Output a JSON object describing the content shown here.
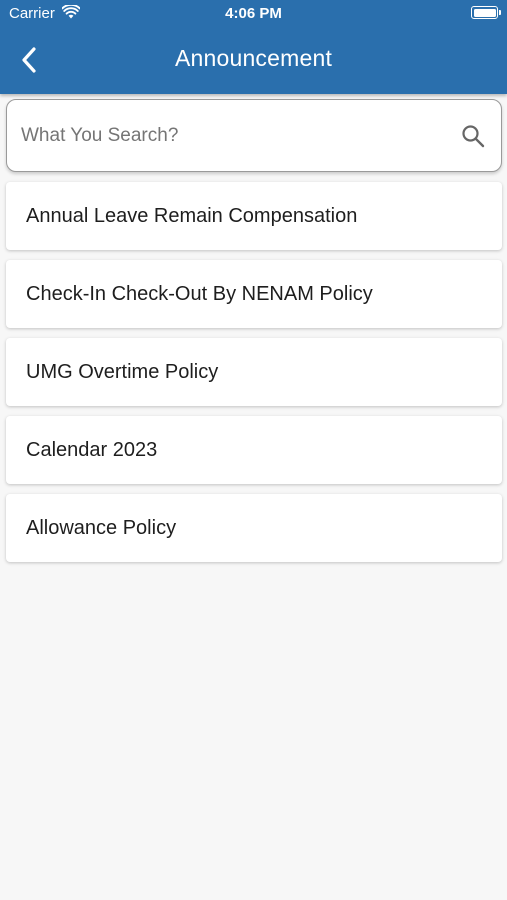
{
  "status_bar": {
    "carrier": "Carrier",
    "time": "4:06 PM",
    "wifi_icon": "wifi-icon",
    "battery_icon": "battery-icon"
  },
  "header": {
    "title": "Announcement",
    "back_icon": "chevron-left-icon",
    "background_color": "#2a6fad"
  },
  "search": {
    "placeholder": "What You Search?",
    "value": "",
    "icon": "search-icon"
  },
  "announcements": [
    {
      "title": "Annual Leave Remain Compensation"
    },
    {
      "title": "Check-In Check-Out By NENAM Policy"
    },
    {
      "title": "UMG Overtime Policy"
    },
    {
      "title": "Calendar 2023"
    },
    {
      "title": "Allowance Policy"
    }
  ]
}
